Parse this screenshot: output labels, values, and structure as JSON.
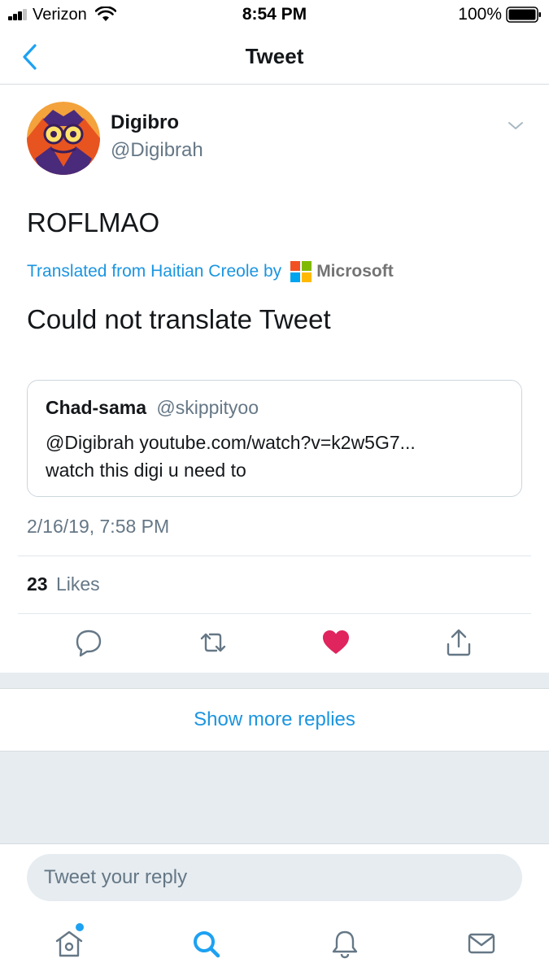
{
  "status_bar": {
    "carrier": "Verizon",
    "time": "8:54 PM",
    "battery_percent": "100%",
    "signal_icon": "cellular-signal-icon",
    "wifi_icon": "wifi-icon",
    "battery_icon": "battery-icon"
  },
  "nav": {
    "title": "Tweet",
    "back_icon": "chevron-left-icon"
  },
  "tweet": {
    "author_name": "Digibro",
    "author_handle": "@Digibrah",
    "text": "ROFLMAO",
    "translated_label": "Translated from Haitian Creole by",
    "translator_name": "Microsoft",
    "translation": "Could not translate Tweet",
    "timestamp": "2/16/19, 7:58 PM",
    "likes_count": "23",
    "likes_label": "Likes",
    "liked": true
  },
  "quoted_tweet": {
    "author_name": "Chad-sama",
    "author_handle": "@skippityoo",
    "line1": "@Digibrah youtube.com/watch?v=k2w5G7...",
    "line2": "watch this digi u need to"
  },
  "actions": [
    "reply-icon",
    "retweet-icon",
    "heart-icon",
    "share-icon"
  ],
  "show_more_replies": "Show more replies",
  "reply_box": {
    "placeholder": "Tweet your reply"
  },
  "tab_bar": [
    "home-icon",
    "search-icon",
    "notifications-bell-icon",
    "messages-envelope-icon"
  ],
  "colors": {
    "accent": "#1DA1F2",
    "link": "#1B95E0",
    "like": "#E0245E",
    "text_primary": "#14171A",
    "text_secondary": "#657786",
    "divider": "#E1E8ED",
    "background_band": "#E6ECF0",
    "microsoft_red": "#F25022",
    "microsoft_green": "#7FBA00",
    "microsoft_blue": "#00A4EF",
    "microsoft_yellow": "#FFB900"
  }
}
